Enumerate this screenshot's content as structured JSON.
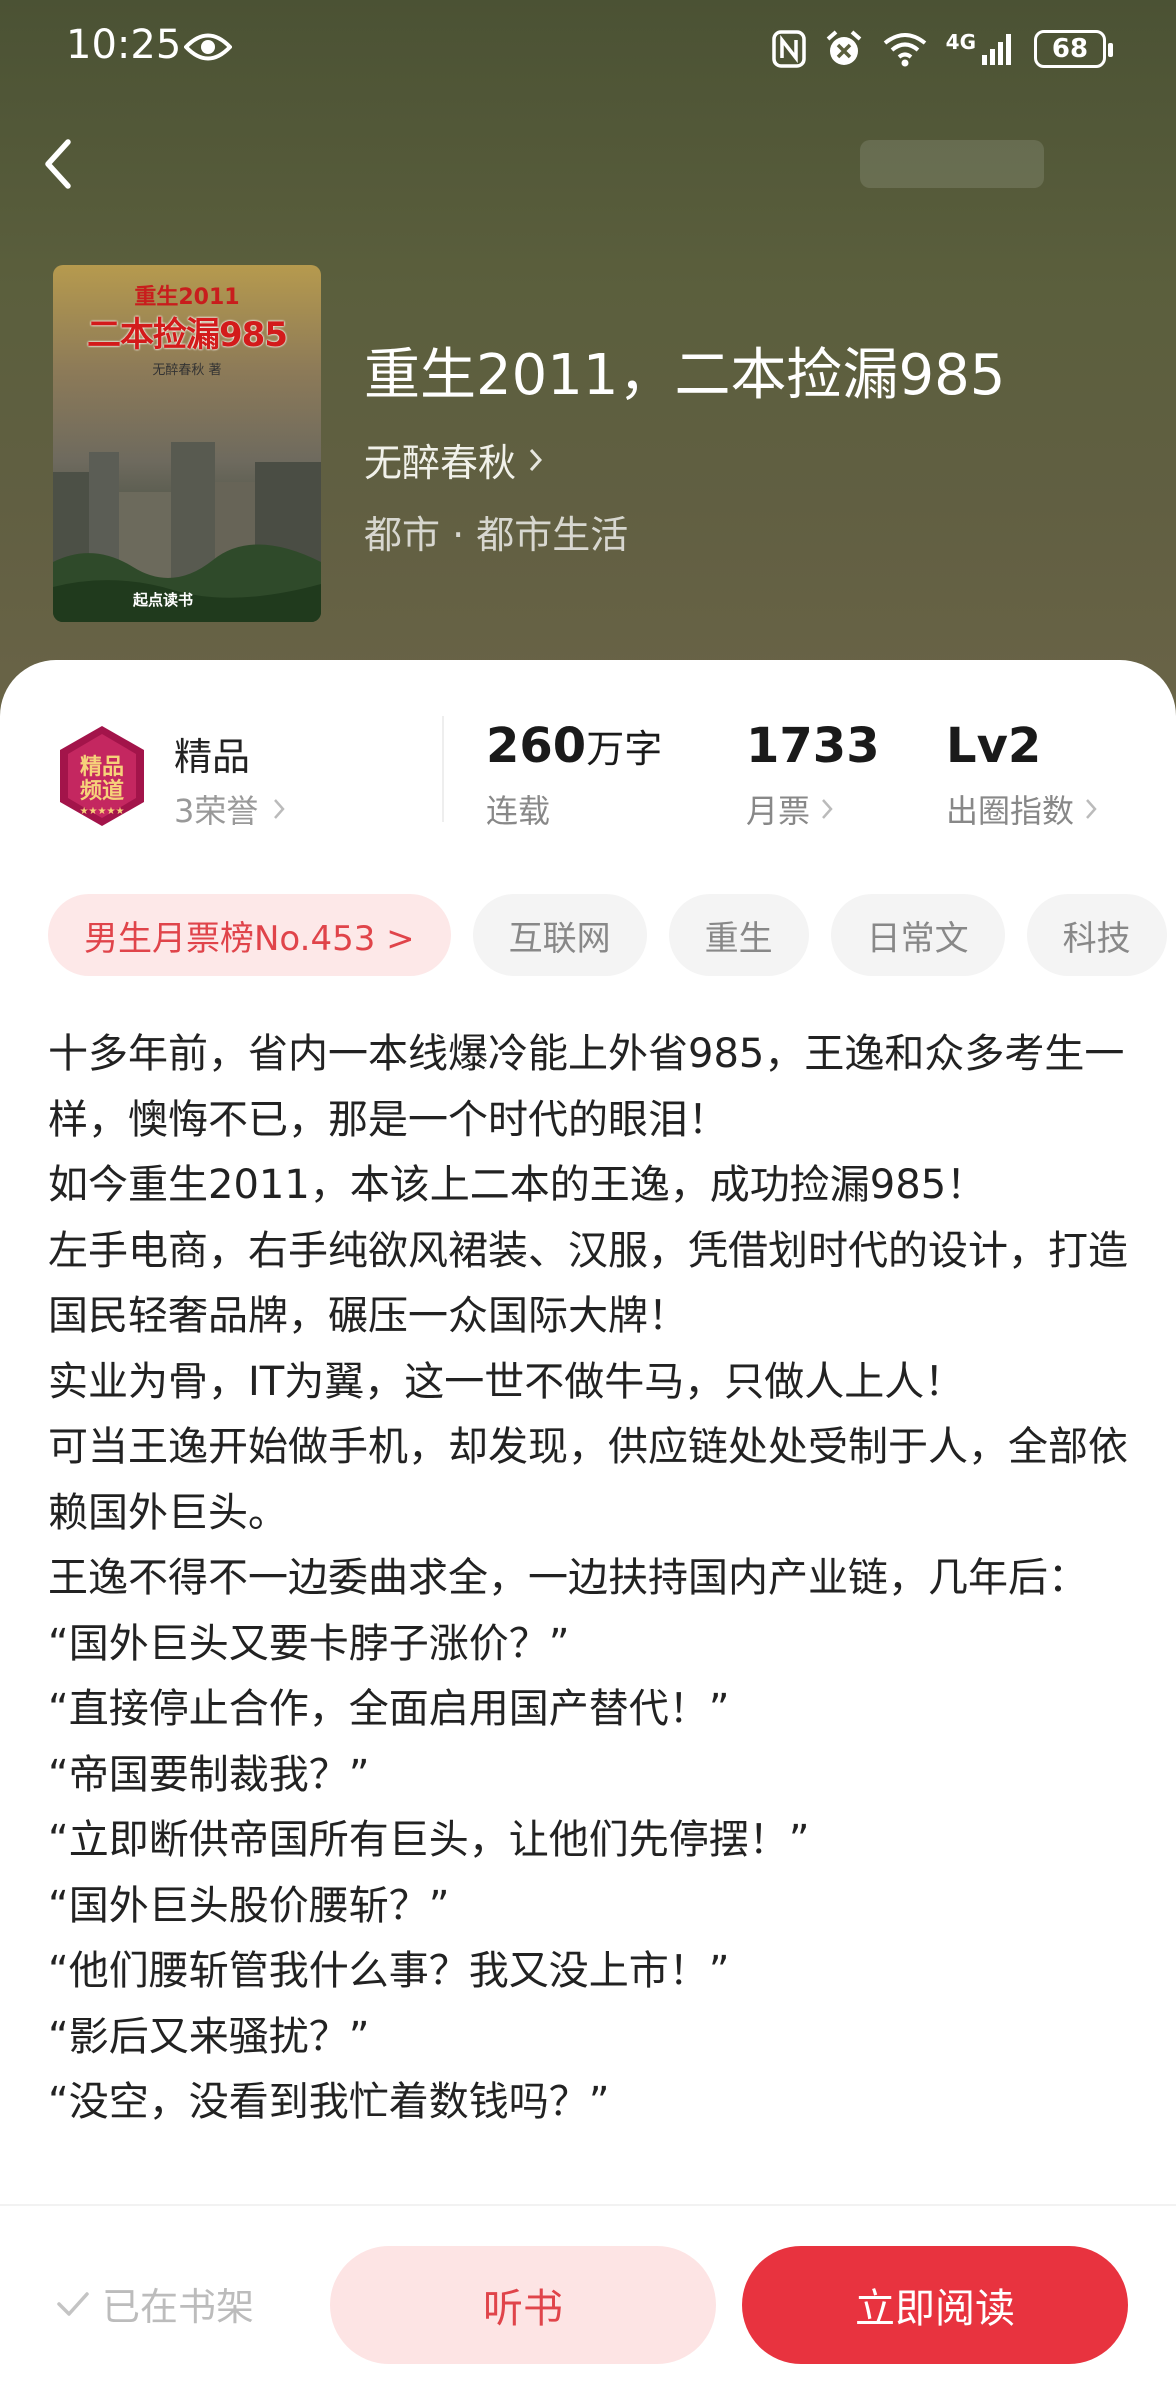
{
  "status_bar": {
    "time": "10:25",
    "network": "4G",
    "battery": "68"
  },
  "book": {
    "title": "重生2011，二本捡漏985",
    "author": "无醉春秋",
    "genre": "都市 · 都市生活",
    "cover": {
      "title_small": "重生2011",
      "title_main": "二本捡漏985",
      "author": "无醉春秋 著",
      "publisher": "起点读书"
    }
  },
  "badge": {
    "name": "精品",
    "honors": "3荣誉",
    "medal_text": "精品频道"
  },
  "stats": [
    {
      "value": "260",
      "unit": "万字",
      "label": "连载"
    },
    {
      "value": "1733",
      "unit": "",
      "label": "月票"
    },
    {
      "value": "Lv2",
      "unit": "",
      "label": "出圈指数"
    }
  ],
  "tags": [
    "男生月票榜No.453 >",
    "互联网",
    "重生",
    "日常文",
    "科技"
  ],
  "synopsis": [
    "十多年前，省内一本线爆冷能上外省985，王逸和众多考生一样，懊悔不已，那是一个时代的眼泪！",
    "如今重生2011，本该上二本的王逸，成功捡漏985！",
    "左手电商，右手纯欲风裙装、汉服，凭借划时代的设计，打造国民轻奢品牌，碾压一众国际大牌！",
    "实业为骨，IT为翼，这一世不做牛马，只做人上人！",
    "可当王逸开始做手机，却发现，供应链处处受制于人，全部依赖国外巨头。",
    "王逸不得不一边委曲求全，一边扶持国内产业链，几年后：",
    "“国外巨头又要卡脖子涨价？”",
    "“直接停止合作，全面启用国产替代！”",
    "“帝国要制裁我？”",
    "“立即断供帝国所有巨头，让他们先停摆！”",
    "“国外巨头股价腰斩？”",
    "“他们腰斩管我什么事？我又没上市！”",
    "“影后又来骚扰？”",
    "“没空，没看到我忙着数钱吗？”"
  ],
  "bottom_bar": {
    "shelf_status": "已在书架",
    "listen_label": "听书",
    "read_label": "立即阅读"
  },
  "colors": {
    "accent": "#e8333f",
    "accent_light": "#fde4e4",
    "hero_bg": "#5b5f3d"
  }
}
